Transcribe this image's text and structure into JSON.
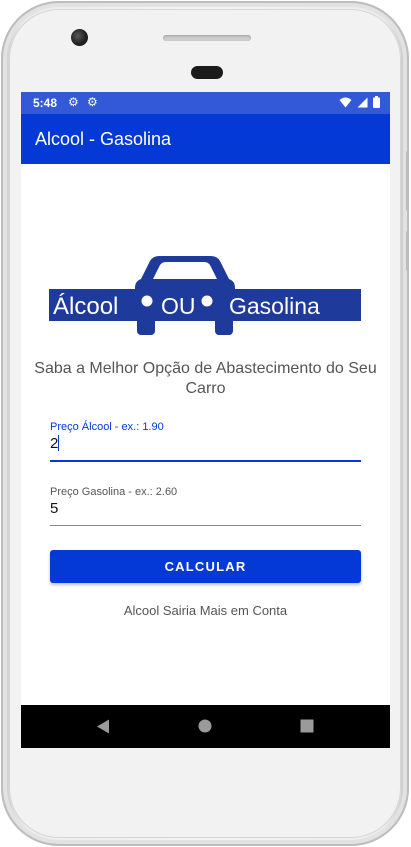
{
  "status_bar": {
    "time": "5:48",
    "icons_left": [
      "gear-icon",
      "gear-icon"
    ],
    "icons_right": [
      "wifi-icon",
      "signal-icon",
      "battery-icon"
    ]
  },
  "app_bar": {
    "title": "Alcool - Gasolina"
  },
  "logo": {
    "left_text": "Álcool",
    "middle_text": "OU",
    "right_text": "Gasolina",
    "color": "#1e3a9b"
  },
  "subtitle": "Saba a Melhor Opção de Abastecimento do Seu Carro",
  "fields": {
    "alcool": {
      "label": "Preço Álcool - ex.: 1.90",
      "value": "2",
      "focused": true
    },
    "gasolina": {
      "label": "Preço Gasolina - ex.: 2.60",
      "value": "5",
      "focused": false
    }
  },
  "button": {
    "label": "CALCULAR"
  },
  "result": "Alcool Sairia Mais em Conta",
  "nav": {
    "icons": [
      "back-icon",
      "home-icon",
      "recents-icon"
    ]
  },
  "colors": {
    "primary": "#0439d6",
    "status_bar": "#3358d8",
    "logo_blue": "#1e3a9b"
  }
}
